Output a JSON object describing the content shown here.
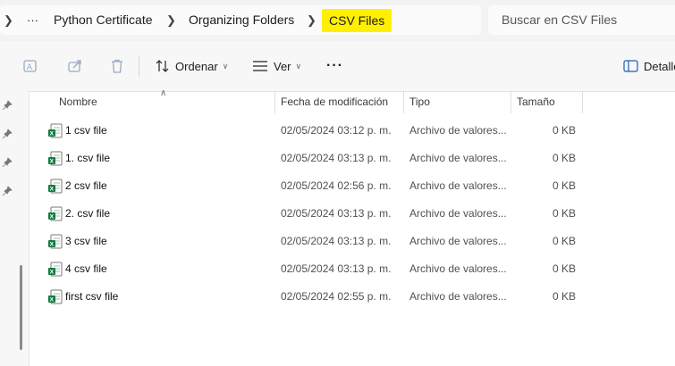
{
  "breadcrumb": {
    "items": [
      "Python Certificate",
      "Organizing Folders",
      "CSV Files"
    ],
    "more": "···"
  },
  "search": {
    "placeholder": "Buscar en CSV Files"
  },
  "toolbar": {
    "sort_label": "Ordenar",
    "view_label": "Ver",
    "more": "···",
    "details_label": "Detalle"
  },
  "columns": {
    "name": "Nombre",
    "date": "Fecha de modificación",
    "type": "Tipo",
    "size": "Tamaño"
  },
  "files": [
    {
      "name": "1 csv file",
      "date": "02/05/2024 03:12 p. m.",
      "type": "Archivo de valores...",
      "size": "0 KB"
    },
    {
      "name": "1. csv file",
      "date": "02/05/2024 03:13 p. m.",
      "type": "Archivo de valores...",
      "size": "0 KB"
    },
    {
      "name": "2 csv file",
      "date": "02/05/2024 02:56 p. m.",
      "type": "Archivo de valores...",
      "size": "0 KB"
    },
    {
      "name": "2. csv file",
      "date": "02/05/2024 03:13 p. m.",
      "type": "Archivo de valores...",
      "size": "0 KB"
    },
    {
      "name": "3 csv file",
      "date": "02/05/2024 03:13 p. m.",
      "type": "Archivo de valores...",
      "size": "0 KB"
    },
    {
      "name": "4 csv file",
      "date": "02/05/2024 03:13 p. m.",
      "type": "Archivo de valores...",
      "size": "0 KB"
    },
    {
      "name": "first csv file",
      "date": "02/05/2024 02:55 p. m.",
      "type": "Archivo de valores...",
      "size": "0 KB"
    }
  ],
  "icons": {
    "file": "excel-csv-icon",
    "pin": "pin-icon",
    "rename": "rename-icon",
    "share": "share-icon",
    "delete": "delete-icon",
    "sort": "sort-icon",
    "view": "view-icon",
    "details": "details-pane-icon"
  },
  "colors": {
    "highlight": "#ffef00",
    "excel_green": "#107c41"
  }
}
